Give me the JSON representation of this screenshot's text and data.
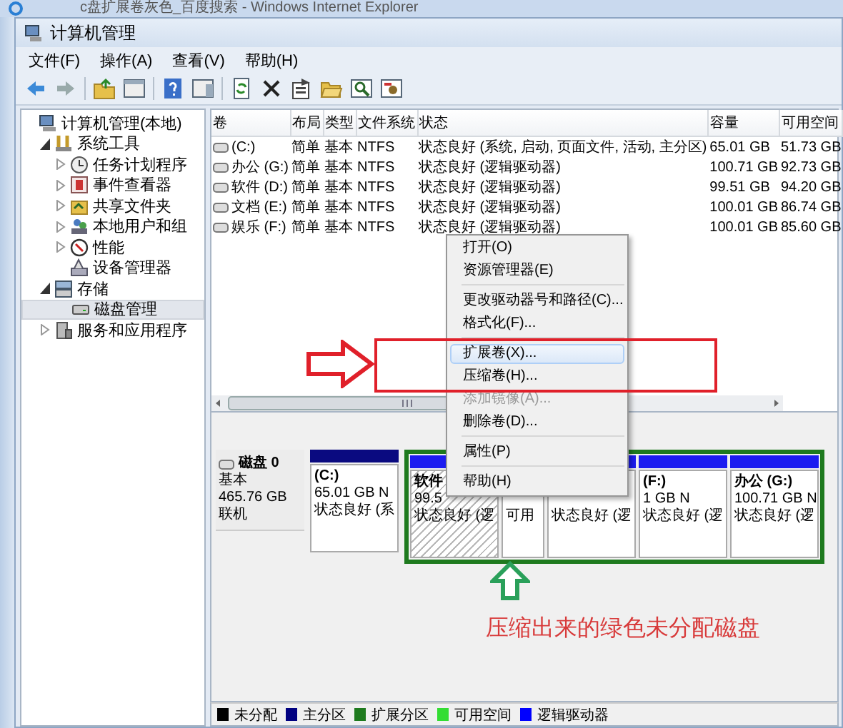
{
  "browser_window": {
    "title": "c盘扩展卷灰色_百度搜索 - Windows Internet Explorer"
  },
  "window": {
    "title": "计算机管理"
  },
  "menu_bar": [
    "文件(F)",
    "操作(A)",
    "查看(V)",
    "帮助(H)"
  ],
  "tree": [
    {
      "label": "计算机管理(本地)",
      "selected": false,
      "children": [
        {
          "label": "系统工具",
          "expanded": true,
          "selected": false,
          "children": [
            {
              "label": "任务计划程序",
              "expanded": false,
              "selected": false
            },
            {
              "label": "事件查看器",
              "expanded": false,
              "selected": false
            },
            {
              "label": "共享文件夹",
              "expanded": false,
              "selected": false
            },
            {
              "label": "本地用户和组",
              "expanded": false,
              "selected": false
            },
            {
              "label": "性能",
              "expanded": false,
              "selected": false
            },
            {
              "label": "设备管理器",
              "selected": false
            }
          ]
        },
        {
          "label": "存储",
          "expanded": true,
          "selected": false,
          "children": [
            {
              "label": "磁盘管理",
              "selected": true
            }
          ]
        },
        {
          "label": "服务和应用程序",
          "expanded": false,
          "selected": false
        }
      ]
    }
  ],
  "volumes": {
    "columns": [
      "卷",
      "布局",
      "类型",
      "文件系统",
      "状态",
      "容量",
      "可用空间"
    ],
    "rows": [
      [
        "(C:)",
        "简单",
        "基本",
        "NTFS",
        "状态良好 (系统, 启动, 页面文件, 活动, 主分区)",
        "65.01 GB",
        "51.73 GB"
      ],
      [
        "办公 (G:)",
        "简单",
        "基本",
        "NTFS",
        "状态良好 (逻辑驱动器)",
        "100.71 GB",
        "92.73 GB"
      ],
      [
        "软件 (D:)",
        "简单",
        "基本",
        "NTFS",
        "状态良好 (逻辑驱动器)",
        "99.51 GB",
        "94.20 GB"
      ],
      [
        "文档 (E:)",
        "简单",
        "基本",
        "NTFS",
        "状态良好 (逻辑驱动器)",
        "100.01 GB",
        "86.74 GB"
      ],
      [
        "娱乐 (F:)",
        "简单",
        "基本",
        "NTFS",
        "状态良好 (逻辑驱动器)",
        "100.01 GB",
        "85.60 GB"
      ]
    ]
  },
  "disk_map": {
    "disk": {
      "name": "磁盘 0",
      "type": "基本",
      "size": "465.76 GB",
      "status": "联机"
    },
    "partitions": [
      {
        "kind": "primary",
        "name": "(C:)",
        "size": "65.01 GB N",
        "status": "状态良好 (系",
        "selected": false
      },
      {
        "kind": "logical",
        "name": "软件",
        "size": "99.5",
        "status": "状态良好 (逻",
        "selected": true
      },
      {
        "kind": "free",
        "status": "可用",
        "selected": false
      },
      {
        "kind": "logical",
        "status": "状态良好 (逻",
        "selected": false
      },
      {
        "kind": "logical",
        "name": "(F:)",
        "size": "1 GB N",
        "status": "状态良好 (逻",
        "selected": false
      },
      {
        "kind": "logical",
        "name": "办公 (G:)",
        "size": "100.71 GB N",
        "status": "状态良好 (逻",
        "selected": false
      }
    ]
  },
  "legend": [
    {
      "label": "未分配",
      "color": "#000000"
    },
    {
      "label": "主分区",
      "color": "#000080"
    },
    {
      "label": "扩展分区",
      "color": "#1e7a1e"
    },
    {
      "label": "可用空间",
      "color": "#33dd33"
    },
    {
      "label": "逻辑驱动器",
      "color": "#0000ff"
    }
  ],
  "context_menu": [
    {
      "kind": "item",
      "label": "打开(O)",
      "disabled": false,
      "selected": false
    },
    {
      "kind": "item",
      "label": "资源管理器(E)",
      "disabled": false,
      "selected": false
    },
    {
      "kind": "separator"
    },
    {
      "kind": "item",
      "label": "更改驱动器号和路径(C)...",
      "disabled": false,
      "selected": false
    },
    {
      "kind": "item",
      "label": "格式化(F)...",
      "disabled": false,
      "selected": false
    },
    {
      "kind": "separator"
    },
    {
      "kind": "item",
      "label": "扩展卷(X)...",
      "disabled": false,
      "selected": true
    },
    {
      "kind": "item",
      "label": "压缩卷(H)...",
      "disabled": false,
      "selected": false
    },
    {
      "kind": "item",
      "label": "添加镜像(A)...",
      "disabled": true,
      "selected": false
    },
    {
      "kind": "item",
      "label": "删除卷(D)...",
      "disabled": false,
      "selected": false
    },
    {
      "kind": "separator"
    },
    {
      "kind": "item",
      "label": "属性(P)",
      "disabled": false,
      "selected": false
    },
    {
      "kind": "separator"
    },
    {
      "kind": "item",
      "label": "帮助(H)",
      "disabled": false,
      "selected": false
    }
  ],
  "annotation": {
    "caption": "压缩出来的绿色未分配磁盘"
  }
}
